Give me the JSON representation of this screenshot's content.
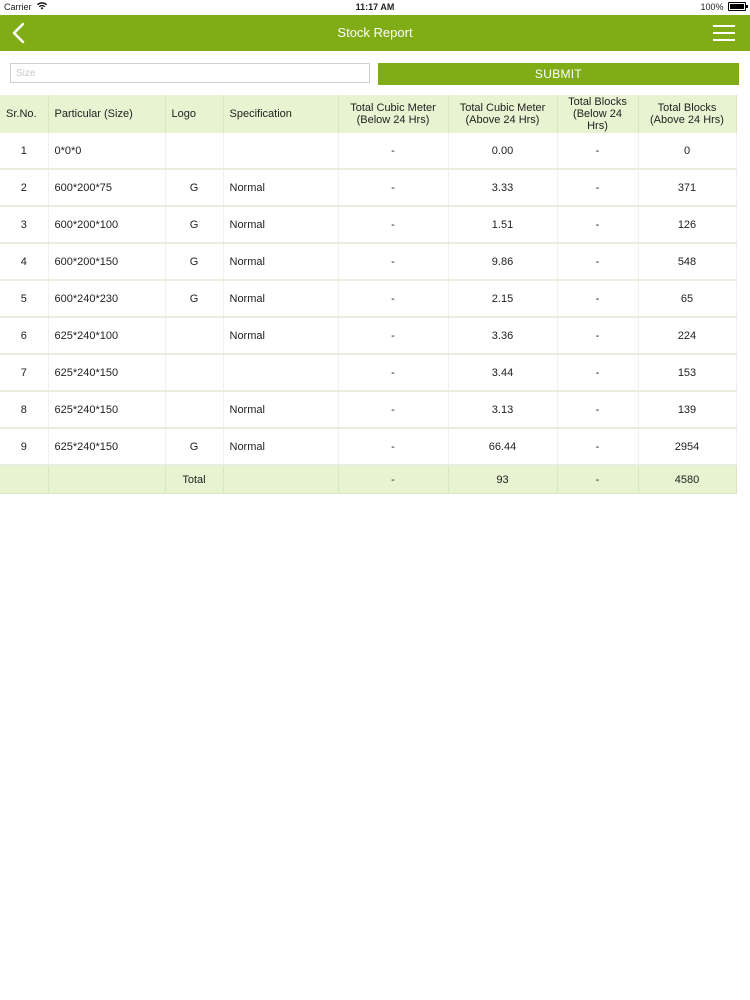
{
  "status_bar": {
    "carrier": "Carrier",
    "time": "11:17 AM",
    "battery": "100%"
  },
  "nav": {
    "title": "Stock Report"
  },
  "search": {
    "placeholder": "Size",
    "submit_label": "SUBMIT"
  },
  "colors": {
    "accent": "#80ad16",
    "header_bg": "#e8f3d1"
  },
  "table": {
    "headers": [
      "Sr.No.",
      "Particular (Size)",
      "Logo",
      "Specification",
      "Total Cubic Meter (Below 24 Hrs)",
      "Total Cubic Meter (Above 24 Hrs)",
      "Total Blocks (Below 24 Hrs)",
      "Total Blocks (Above 24 Hrs)"
    ],
    "rows": [
      [
        "1",
        "0*0*0",
        "",
        "",
        "-",
        "0.00",
        "-",
        "0"
      ],
      [
        "2",
        "600*200*75",
        "G",
        "Normal",
        "-",
        "3.33",
        "-",
        "371"
      ],
      [
        "3",
        "600*200*100",
        "G",
        "Normal",
        "-",
        "1.51",
        "-",
        "126"
      ],
      [
        "4",
        "600*200*150",
        "G",
        "Normal",
        "-",
        "9.86",
        "-",
        "548"
      ],
      [
        "5",
        "600*240*230",
        "G",
        "Normal",
        "-",
        "2.15",
        "-",
        "65"
      ],
      [
        "6",
        "625*240*100",
        "",
        "Normal",
        "-",
        "3.36",
        "-",
        "224"
      ],
      [
        "7",
        "625*240*150",
        "",
        "",
        "-",
        "3.44",
        "-",
        "153"
      ],
      [
        "8",
        "625*240*150",
        "",
        "Normal",
        "-",
        "3.13",
        "-",
        "139"
      ],
      [
        "9",
        "625*240*150",
        "G",
        "Normal",
        "-",
        "66.44",
        "-",
        "2954"
      ]
    ],
    "total": [
      "",
      "",
      "Total",
      "",
      "-",
      "93",
      "-",
      "4580"
    ]
  }
}
